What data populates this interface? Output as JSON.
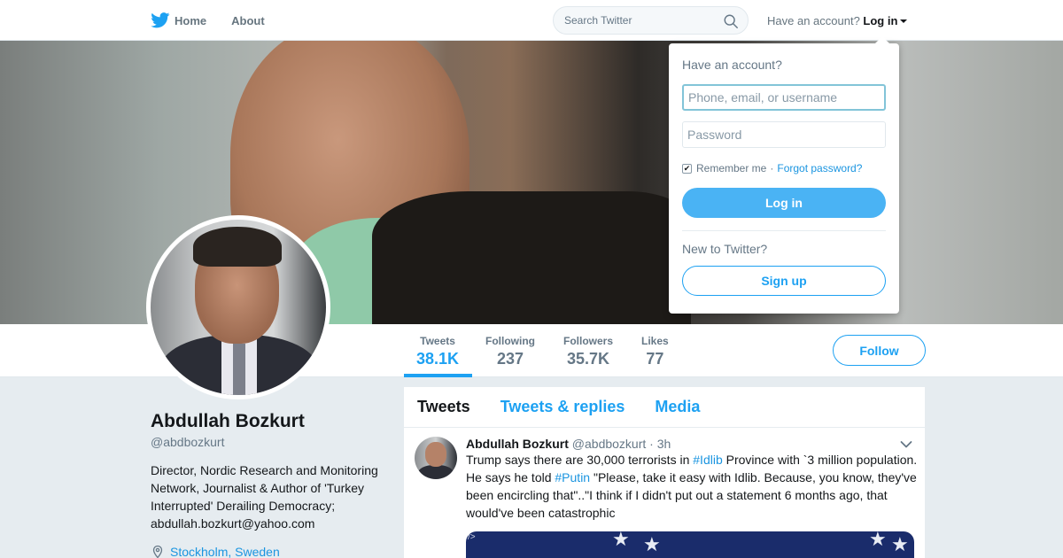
{
  "nav": {
    "home_label": "Home",
    "about_label": "About",
    "search_placeholder": "Search Twitter",
    "have_account": "Have an account?",
    "login_label": "Log in"
  },
  "profile": {
    "name": "Abdullah Bozkurt",
    "handle": "@abdbozkurt",
    "bio": "Director, Nordic Research and Monitoring Network, Journalist & Author of 'Turkey Interrupted' Derailing Democracy; abdullah.bozkurt@yahoo.com",
    "location": "Stockholm, Sweden",
    "follow_label": "Follow"
  },
  "stats": [
    {
      "label": "Tweets",
      "value": "38.1K"
    },
    {
      "label": "Following",
      "value": "237"
    },
    {
      "label": "Followers",
      "value": "35.7K"
    },
    {
      "label": "Likes",
      "value": "77"
    }
  ],
  "timeline": {
    "tabs": [
      "Tweets",
      "Tweets & replies",
      "Media"
    ],
    "tweet": {
      "name": "Abdullah Bozkurt",
      "handle": "@abdbozkurt",
      "separator": "·",
      "time": "3h",
      "text_1": "Trump says there are 30,000 terrorists in ",
      "tag_1": "#Idlib",
      "text_2": " Province with `3 million population. He says he told ",
      "tag_2": "#Putin",
      "text_3": " \"Please, take it easy with Idlib. Because, you know, they've been encircling that\"..\"I think if I didn't put out a statement 6 months ago, that would've been catastrophic",
      "media_label": "/>"
    }
  },
  "login_dropdown": {
    "title": "Have an account?",
    "username_placeholder": "Phone, email, or username",
    "password_placeholder": "Password",
    "remember_label": "Remember me",
    "separator": "·",
    "forgot_label": "Forgot password?",
    "login_button": "Log in",
    "new_label": "New to Twitter?",
    "signup_button": "Sign up"
  },
  "colors": {
    "accent": "#1da1f2",
    "link": "#1b95e0",
    "login_button_bg": "#4ab3f4"
  }
}
